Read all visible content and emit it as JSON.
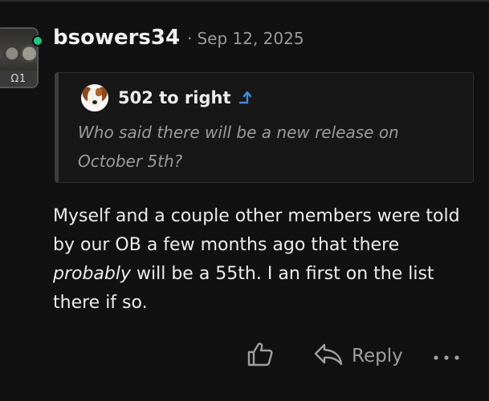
{
  "post": {
    "avatar_badge": "Ω1",
    "username": "bsowers34",
    "separator": "·",
    "date": "Sep 12, 2025",
    "online_color": "#1fc77f",
    "quote": {
      "author": "502 to right",
      "author_avatar_icon": "dog-avatar",
      "jump_icon": "arrow-up-icon",
      "text": "Who said there will be a new release on October 5th?"
    },
    "body": {
      "part1": "Myself and a couple other members were told by our OB a few months ago that there ",
      "emphasis": "probably",
      "part2": " will be a 55th. I an first on the list there if so."
    },
    "actions": {
      "like_icon": "thumbs-up-icon",
      "reply_icon": "reply-arrow-icon",
      "reply_label": "Reply",
      "more_icon": "ellipsis-icon"
    }
  }
}
